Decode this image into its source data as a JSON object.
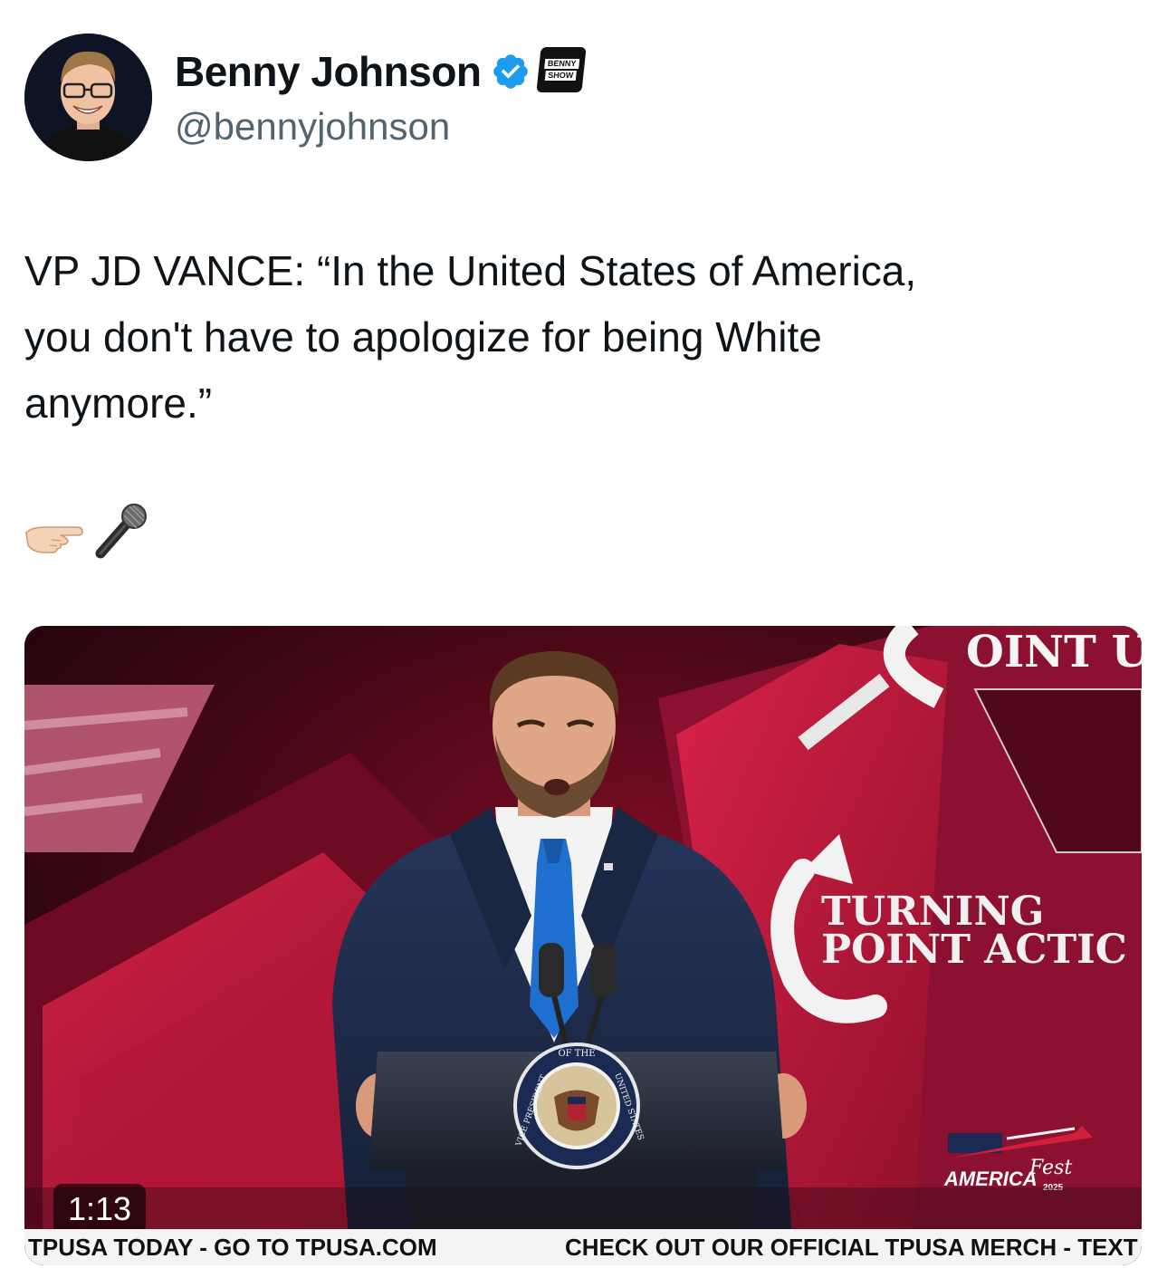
{
  "author": {
    "display_name": "Benny Johnson",
    "handle": "@bennyjohnson",
    "verified": true,
    "verified_color": "#1d9bf0",
    "affiliate_badge_text": [
      "BENNY",
      "SHOW"
    ]
  },
  "tweet": {
    "text_line1": "VP JD VANCE: “In the United States of America,",
    "text_line2": "you don't have to apologize for being White",
    "text_line3": "anymore.”",
    "emojis": [
      "hand-pointing-icon",
      "microphone-icon"
    ]
  },
  "video": {
    "duration": "1:13",
    "backdrop_text_top": "OINT U",
    "backdrop_text_line1": "TURNING",
    "backdrop_text_line2": "POINT ACTIC",
    "seal_text_top": "OF THE",
    "seal_text_left": "VICE PRESIDENT",
    "seal_text_right": "UNITED STATES",
    "event_logo_text": "AMERICA",
    "event_logo_script": "Fest",
    "event_logo_year": "2025",
    "ticker_left": "TPUSA TODAY - GO TO TPUSA.COM",
    "ticker_right": "CHECK OUT OUR OFFICIAL TPUSA MERCH - TEXT",
    "colors": {
      "backdrop_red": "#c2183a",
      "backdrop_dark": "#3a0612",
      "suit": "#1c2a4a",
      "tie": "#1f6fd1"
    }
  }
}
